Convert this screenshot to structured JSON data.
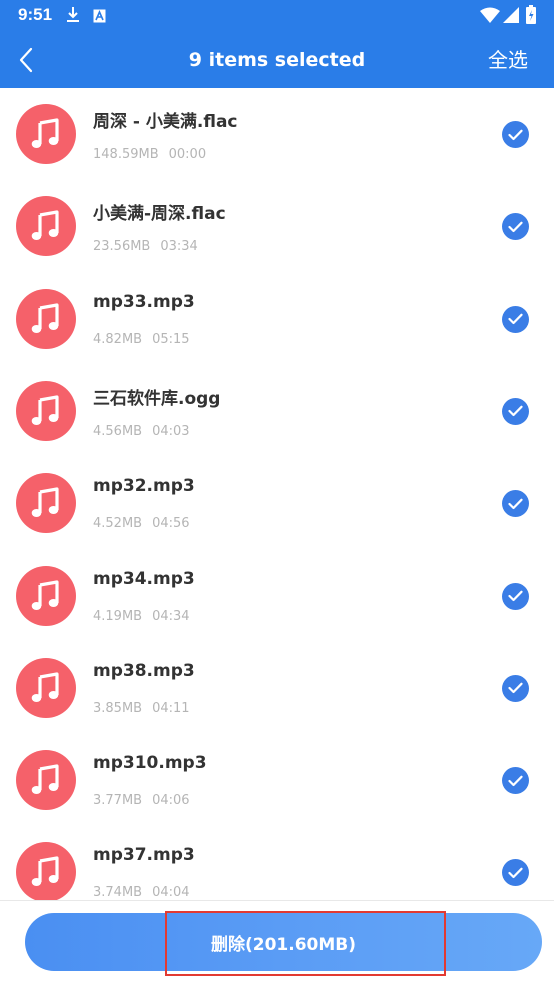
{
  "status_bar": {
    "time": "9:51",
    "icons": [
      "download-icon",
      "a-badge-icon",
      "wifi-icon",
      "signal-icon",
      "battery-icon"
    ]
  },
  "app_bar": {
    "title": "9 items selected",
    "select_all_label": "全选",
    "back_icon": "chevron-left-icon"
  },
  "colors": {
    "primary": "#2a7de8",
    "avatar": "#f5616a",
    "check": "#3a7de6",
    "highlight": "#e23a32"
  },
  "files": [
    {
      "name": "周深 - 小美满.flac",
      "size": "148.59MB",
      "duration": "00:00",
      "checked": true
    },
    {
      "name": "小美满-周深.flac",
      "size": "23.56MB",
      "duration": "03:34",
      "checked": true
    },
    {
      "name": "mp33.mp3",
      "size": "4.82MB",
      "duration": "05:15",
      "checked": true
    },
    {
      "name": "三石软件库.ogg",
      "size": "4.56MB",
      "duration": "04:03",
      "checked": true
    },
    {
      "name": "mp32.mp3",
      "size": "4.52MB",
      "duration": "04:56",
      "checked": true
    },
    {
      "name": "mp34.mp3",
      "size": "4.19MB",
      "duration": "04:34",
      "checked": true
    },
    {
      "name": "mp38.mp3",
      "size": "3.85MB",
      "duration": "04:11",
      "checked": true
    },
    {
      "name": "mp310.mp3",
      "size": "3.77MB",
      "duration": "04:06",
      "checked": true
    },
    {
      "name": "mp37.mp3",
      "size": "3.74MB",
      "duration": "04:04",
      "checked": true
    }
  ],
  "bottom": {
    "delete_label": "删除(201.60MB)"
  }
}
